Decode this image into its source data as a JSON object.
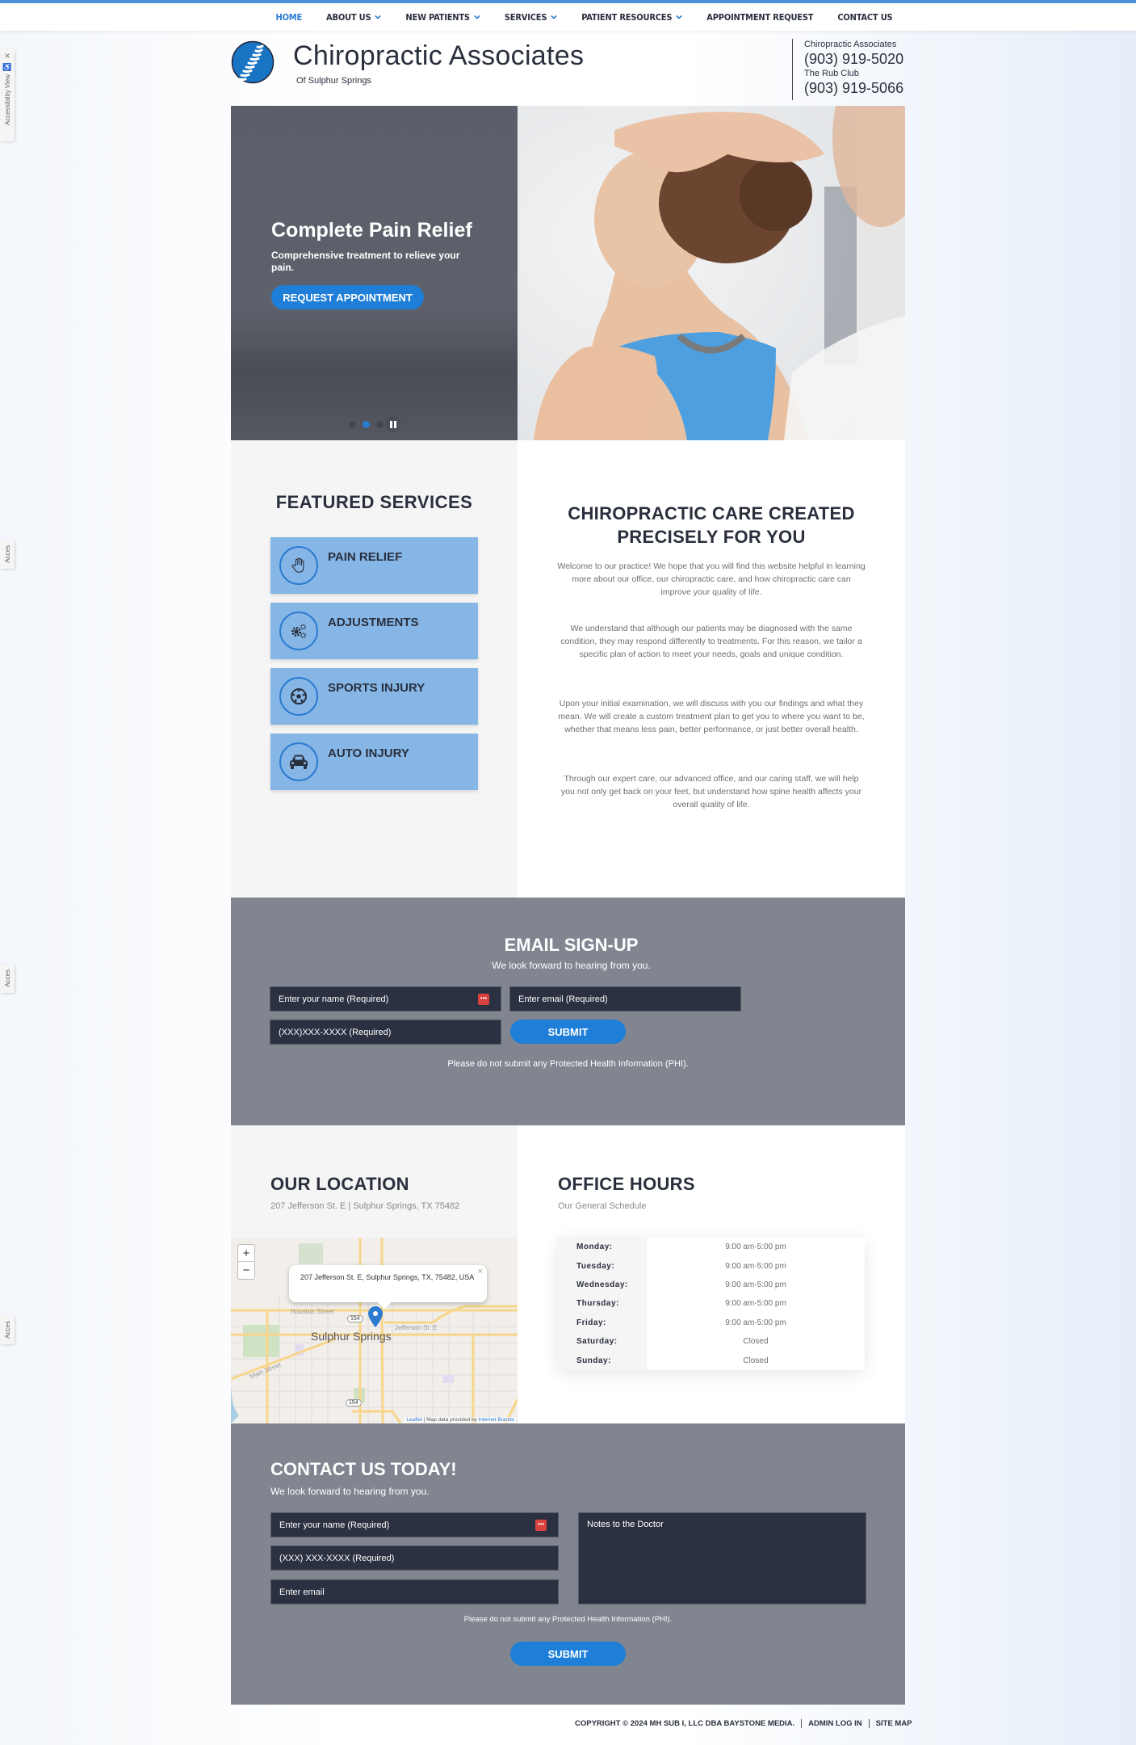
{
  "nav": {
    "items": [
      {
        "label": "HOME",
        "active": true,
        "dropdown": false
      },
      {
        "label": "ABOUT US",
        "active": false,
        "dropdown": true
      },
      {
        "label": "NEW PATIENTS",
        "active": false,
        "dropdown": true
      },
      {
        "label": "SERVICES",
        "active": false,
        "dropdown": true
      },
      {
        "label": "PATIENT RESOURCES",
        "active": false,
        "dropdown": true
      },
      {
        "label": "APPOINTMENT REQUEST",
        "active": false,
        "dropdown": false
      },
      {
        "label": "CONTACT US",
        "active": false,
        "dropdown": false
      }
    ]
  },
  "header": {
    "brand": "Chiropractic Associates",
    "brand_sub": "Of Sulphur Springs",
    "logo_icon": "spine-icon",
    "contacts": [
      {
        "label": "Chiropractic Associates",
        "phone": "(903) 919-5020"
      },
      {
        "label": "The Rub Club",
        "phone": "(903) 919-5066"
      }
    ]
  },
  "hero": {
    "title": "Complete Pain Relief",
    "subtitle": "Comprehensive treatment to relieve your pain.",
    "cta": "REQUEST APPOINTMENT",
    "slide_count": 3,
    "active_slide": 2,
    "pause_icon": "pause-icon"
  },
  "features": {
    "title": "FEATURED SERVICES",
    "services": [
      {
        "label": "PAIN RELIEF",
        "icon": "hand-icon"
      },
      {
        "label": "ADJUSTMENTS",
        "icon": "gears-icon"
      },
      {
        "label": "SPORTS INJURY",
        "icon": "soccer-ball-icon"
      },
      {
        "label": "AUTO INJURY",
        "icon": "car-icon"
      }
    ]
  },
  "care": {
    "title": "CHIROPRACTIC CARE CREATED PRECISELY FOR YOU",
    "paragraphs": [
      "Welcome to our practice! We hope that you will find this website helpful in learning more about our office, our chiropractic care, and how chiropractic care can improve your quality of life.",
      "We understand that although our patients may be diagnosed with the same condition, they may respond differently to treatments. For this reason, we tailor a specific plan of action to meet your needs, goals and unique condition.",
      "Upon your initial examination, we will discuss with you our findings and what they mean. We will create a custom treatment plan to get you to where you want to be, whether that means less pain, better performance, or just better overall health.",
      "Through our expert care, our advanced office, and our caring staff, we will help you not only get back on your feet, but understand how spine health affects your overall quality of life."
    ]
  },
  "signup": {
    "title": "EMAIL SIGN-UP",
    "subtitle": "We look forward to hearing from you.",
    "name_placeholder": "Enter your name (Required)",
    "email_placeholder": "Enter email (Required)",
    "phone_placeholder": "(XXX)XXX-XXXX (Required)",
    "submit": "SUBMIT",
    "phi_notice": "Please do not submit any Protected Health Information (PHI)."
  },
  "location": {
    "title": "OUR LOCATION",
    "address": "207 Jefferson St. E | Sulphur Springs, TX 75482",
    "map": {
      "popup": "207 Jefferson St. E, Sulphur Springs, TX, 75482, USA",
      "city_label": "Sulphur Springs",
      "street_labels": [
        "Houston Street",
        "Jefferson St. E",
        "Main Street"
      ],
      "route_labels": [
        "154",
        "154"
      ],
      "zoom_in": "+",
      "zoom_out": "−",
      "attribution_leaflet": "Leaflet",
      "attribution_text": " | Map data provided by ",
      "attribution_provider": "Internet Brands"
    }
  },
  "hours": {
    "title": "OFFICE HOURS",
    "subtitle": "Our General Schedule",
    "rows": [
      {
        "day": "Monday:",
        "time": "9:00 am-5:00 pm"
      },
      {
        "day": "Tuesday:",
        "time": "9:00 am-5:00 pm"
      },
      {
        "day": "Wednesday:",
        "time": "9:00 am-5:00 pm"
      },
      {
        "day": "Thursday:",
        "time": "9:00 am-5:00 pm"
      },
      {
        "day": "Friday:",
        "time": "9:00 am-5:00 pm"
      },
      {
        "day": "Saturday:",
        "time": "Closed"
      },
      {
        "day": "Sunday:",
        "time": "Closed"
      }
    ]
  },
  "contact": {
    "title": "CONTACT US TODAY!",
    "subtitle": "We look forward to hearing from you.",
    "name_placeholder": "Enter your name (Required)",
    "phone_placeholder": "(XXX) XXX-XXXX (Required)",
    "email_placeholder": "Enter email",
    "notes_placeholder": "Notes to the Doctor",
    "phi_notice": "Please do not submit any Protected Health Information (PHI).",
    "submit": "SUBMIT"
  },
  "footer": {
    "copyright": "COPYRIGHT © 2024 MH SUB I, LLC DBA BAYSTONE MEDIA.",
    "admin": "ADMIN LOG IN",
    "sitemap": "SITE MAP"
  },
  "accessibility": {
    "label": "Accessibility View",
    "short_label": "Acces",
    "close": "×"
  },
  "colors": {
    "accent": "#1f7fd8",
    "nav_active": "#2b7bd1",
    "service_tile": "#85b6e6",
    "form_band": "#808590",
    "field_bg": "#2c3142",
    "text_dark": "#2a2f3d"
  }
}
